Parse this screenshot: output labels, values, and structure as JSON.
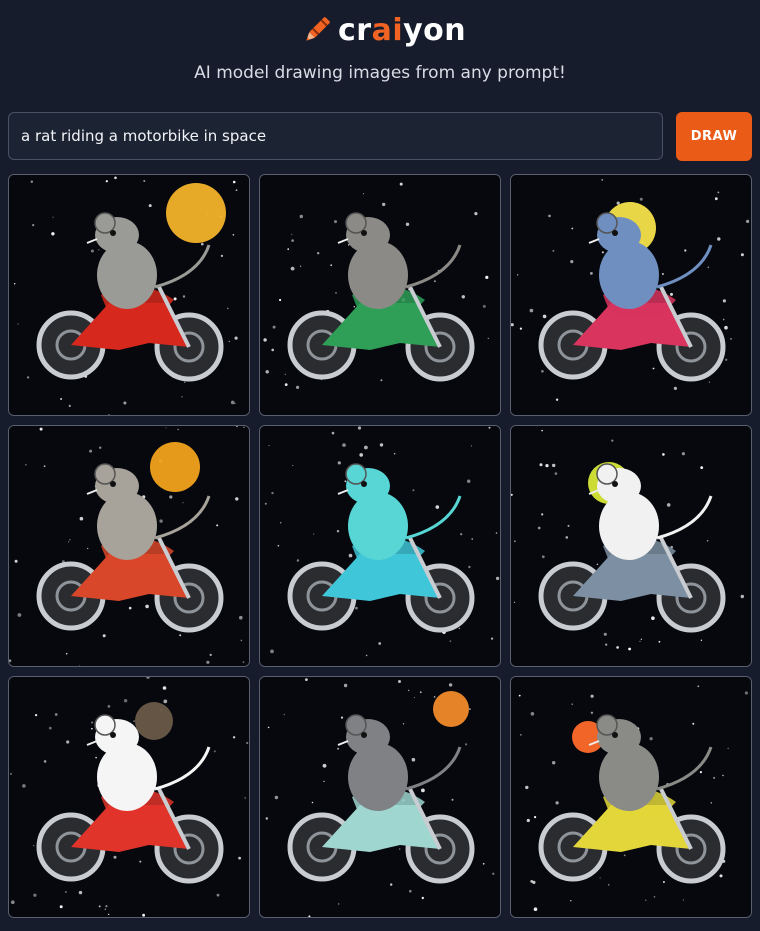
{
  "app": {
    "brand_pre": "cr",
    "brand_ai": "ai",
    "brand_post": "yon",
    "tagline": "AI model drawing images from any prompt!"
  },
  "prompt": {
    "value": "a rat riding a motorbike in space",
    "button_label": "DRAW"
  },
  "colors": {
    "background": "#161c2c",
    "accent": "#e95b17",
    "input_border": "#4a5164"
  },
  "results": [
    {
      "icon": "rat-red-motorbike-image",
      "bike": "#d6281c",
      "rat": "#9a9a96",
      "planet": "#f3b22a"
    },
    {
      "icon": "rat-green-motorbike-image",
      "bike": "#2f9e57",
      "rat": "#8c8a86",
      "planet": null
    },
    {
      "icon": "rat-pink-motorbike-image",
      "bike": "#d8345e",
      "rat": "#6f8fc0",
      "planet": "#f6e14a"
    },
    {
      "icon": "rat-orange-motorbike-image",
      "bike": "#d9472a",
      "rat": "#a8a39a",
      "planet": "#f1a21e"
    },
    {
      "icon": "rat-cyan-motorbike-image",
      "bike": "#3fc6d8",
      "rat": "#58d6d6",
      "planet": null
    },
    {
      "icon": "rat-grey-motorbike-image",
      "bike": "#7c8fa3",
      "rat": "#f1f1f1",
      "planet": "#d7e838"
    },
    {
      "icon": "rat-white-red-motorbike-image",
      "bike": "#e0342a",
      "rat": "#f5f5f5",
      "planet": "#6a5a48"
    },
    {
      "icon": "rat-silver-motorbike-image",
      "bike": "#9fd6d0",
      "rat": "#7f8185",
      "planet": "#f08a2a"
    },
    {
      "icon": "rat-yellow-motorbike-image",
      "bike": "#e2d63a",
      "rat": "#8a8a86",
      "planet": "#ff6a2a"
    }
  ]
}
